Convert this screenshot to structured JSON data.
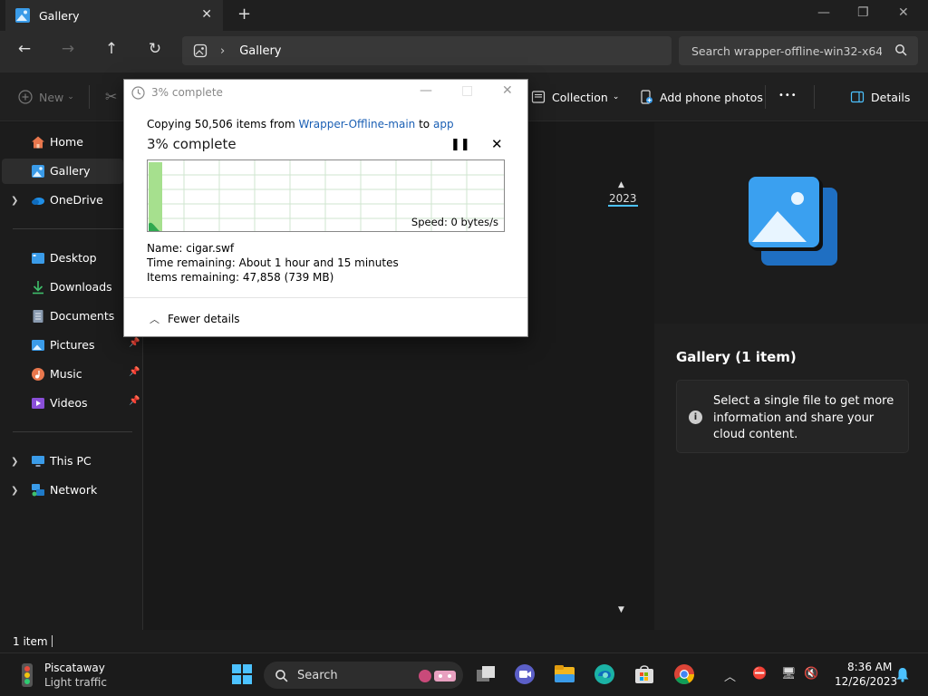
{
  "window": {
    "tab_title": "Gallery",
    "new_tab": "+",
    "close_tab": "✕",
    "minimize": "—",
    "maximize": "❐",
    "close": "✕"
  },
  "address": {
    "back": "←",
    "forward": "→",
    "up": "↑",
    "refresh": "↻",
    "chevron": "›",
    "crumb": "Gallery",
    "search_placeholder": "Search wrapper-offline-win32-x64"
  },
  "toolbar": {
    "new_label": "New",
    "collection_label": "Collection",
    "add_phone_label": "Add phone photos",
    "more_label": "•••",
    "details_label": "Details"
  },
  "sidebar": {
    "home": "Home",
    "gallery": "Gallery",
    "onedrive": "OneDrive",
    "desktop": "Desktop",
    "downloads": "Downloads",
    "documents": "Documents",
    "pictures": "Pictures",
    "music": "Music",
    "videos": "Videos",
    "thispc": "This PC",
    "network": "Network"
  },
  "content": {
    "year": "2023"
  },
  "details": {
    "title": "Gallery (1 item)",
    "info": "Select a single file to get more information and share your cloud content."
  },
  "status": {
    "count": "1 item"
  },
  "dialog": {
    "title": "3% complete",
    "copy_prefix": "Copying 50,506 items from ",
    "source": "Wrapper-Offline-main",
    "to_word": " to ",
    "dest": "app",
    "heading": "3% complete",
    "speed": "Speed: 0 bytes/s",
    "name_line": "Name:  cigar.swf",
    "time_line": "Time remaining:  About 1 hour and 15 minutes",
    "items_line": "Items remaining:  47,858 (739 MB)",
    "fewer_details": "Fewer details",
    "progress": 0.03
  },
  "taskbar": {
    "weather_city": "Piscataway",
    "weather_cond": "Light traffic",
    "search_label": "Search",
    "time": "8:36 AM",
    "date": "12/26/2023"
  },
  "colors": {
    "accent": "#4cc2ff",
    "link": "#1a5fb4",
    "progress_fill": "#a6e08e"
  }
}
